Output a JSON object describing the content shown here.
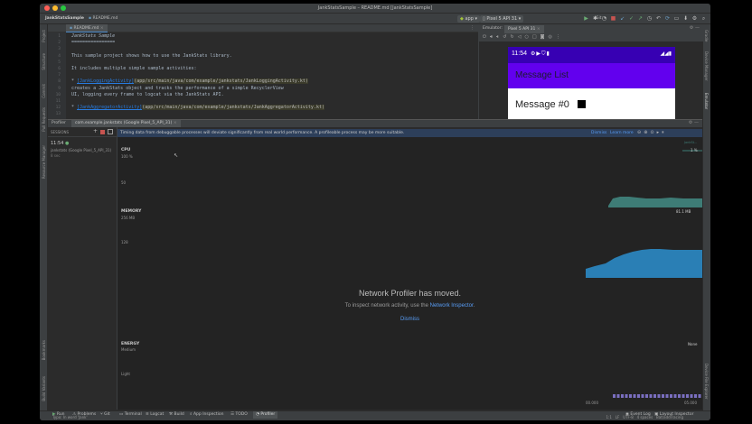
{
  "window": {
    "title": "JankStatsSample – README.md [JankStatsSample]",
    "project": "JankStatsSample",
    "file_breadcrumb": "README.md"
  },
  "toolbar": {
    "run_config": "app",
    "device": "Pixel 5 API 31",
    "git_label": "Git:"
  },
  "left_tabs": [
    "Project",
    "Structure",
    "Commit",
    "Pull Requests",
    "Resource Manager"
  ],
  "left_tabs_bottom": [
    "Bookmarks",
    "Build Variants"
  ],
  "right_tabs": [
    "Gradle",
    "Device Manager",
    "Emulator"
  ],
  "right_tabs_bottom": [
    "Device File Explorer"
  ],
  "editor": {
    "tab": "README.md",
    "line_numbers": [
      "1",
      "2",
      "3",
      "4",
      "5",
      "6",
      "7",
      "8",
      "9",
      "10",
      "11",
      "12",
      "13"
    ],
    "lines": [
      {
        "n": 1,
        "parts": [
          {
            "t": "JankStats Sample",
            "c": "head"
          }
        ]
      },
      {
        "n": 2,
        "parts": [
          {
            "t": "================",
            "c": "plain"
          }
        ]
      },
      {
        "n": 3,
        "parts": []
      },
      {
        "n": 4,
        "parts": [
          {
            "t": "This sample project shows how to use the JankStats library.",
            "c": "plain"
          }
        ]
      },
      {
        "n": 5,
        "parts": []
      },
      {
        "n": 6,
        "parts": [
          {
            "t": "It includes multiple simple sample activities:",
            "c": "plain"
          }
        ]
      },
      {
        "n": 7,
        "parts": []
      },
      {
        "n": 8,
        "parts": [
          {
            "t": "* ",
            "c": "plain"
          },
          {
            "t": "[JankLoggingActivity]",
            "c": "link"
          },
          {
            "t": "(app/src/main/java/com/example/jankstats/JankLoggingActivity.kt)",
            "c": "path"
          }
        ]
      },
      {
        "n": 9,
        "parts": [
          {
            "t": "creates a JankStats object and tracks the performance of a simple RecyclerView",
            "c": "plain"
          }
        ]
      },
      {
        "n": 10,
        "parts": [
          {
            "t": "UI, logging every frame to logcat via the JankStats API.",
            "c": "plain"
          }
        ]
      },
      {
        "n": 11,
        "parts": []
      },
      {
        "n": 12,
        "parts": [
          {
            "t": "* ",
            "c": "plain"
          },
          {
            "t": "[JankAggregatorActivity]",
            "c": "link"
          },
          {
            "t": "(app/src/main/java/com/example/jankstats/JankAggregatorActivity.kt)",
            "c": "path"
          }
        ]
      }
    ]
  },
  "emulator": {
    "label": "Emulator:",
    "device_tab": "Pixel 5 API 31",
    "phone_time": "11:54",
    "app_title": "Message List",
    "first_message": "Message #0"
  },
  "profiler": {
    "tab_label": "Profiler",
    "session_tab": "com.example.jankstats (Google Pixel_5_API_31)",
    "sessions_label": "SESSIONS",
    "session_time": "11:54",
    "session_name": "jankstats (Google Pixel_5_API_31)",
    "session_duration": "8 sec",
    "banner_text": "Timing data from debuggable processes will deviate significantly from real world performance. A profileable process may be more suitable.",
    "banner_dismiss": "Dismiss",
    "banner_learn_more": "Learn more",
    "cpu_label": "CPU",
    "cpu_top": "100 %",
    "cpu_mid": "50",
    "cpu_value": "1 %",
    "cpu_legend": "JankSt...",
    "memory_label": "MEMORY",
    "memory_top": "256 MB",
    "memory_mid": "128",
    "memory_value": "81.1 MB",
    "network_title": "Network Profiler has moved.",
    "network_text_prefix": "To inspect network activity, use the ",
    "network_link": "Network Inspector",
    "network_text_suffix": ".",
    "network_dismiss": "Dismiss",
    "energy_label": "ENERGY",
    "energy_level": "Medium",
    "energy_low": "Light",
    "energy_value": "None",
    "time_start": "00.000",
    "time_end": "05.000"
  },
  "bottom_tabs": [
    "Run",
    "Problems",
    "Git",
    "Terminal",
    "Logcat",
    "Build",
    "App Inspection",
    "TODO",
    "Profiler"
  ],
  "bottom_right": [
    "Event Log",
    "Layout Inspector"
  ],
  "statusbar": {
    "left": "Typo: In word 'Jank'",
    "right": "1:1   LF   UTF-8   4 spaces   Bat/addTracing"
  },
  "colors": {
    "accent_purple": "#6200ee",
    "status_purple": "#3700b3",
    "cpu_green": "#3e7c76",
    "memory_blue": "#2a7fb5",
    "energy_purple": "#7a6fc0",
    "link_blue": "#287bde"
  }
}
